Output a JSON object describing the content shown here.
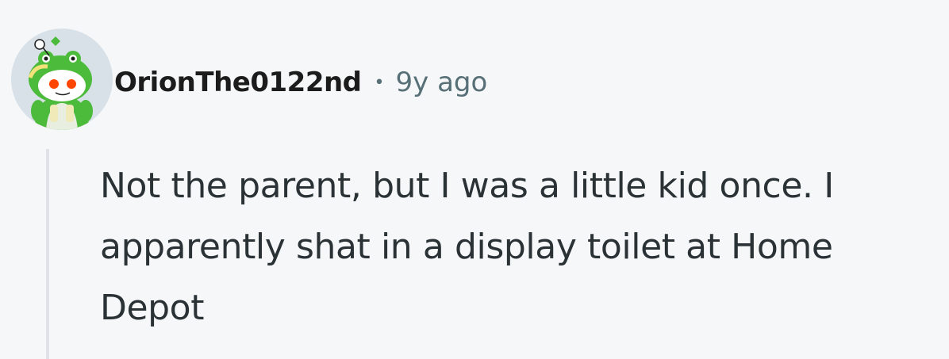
{
  "comment": {
    "author": {
      "username": "OrionThe0122nd",
      "avatar_icon": "snoo-frog-hood-avatar-icon"
    },
    "separator": "•",
    "timestamp": "9y ago",
    "body_lines": [
      "Not the parent, but I was a little kid once. I",
      "apparently shat in a display toilet at Home",
      "Depot"
    ]
  },
  "colors": {
    "background": "#f6f7f8",
    "username": "#1c1c1c",
    "meta": "#576f76",
    "body_text": "#2a3236",
    "thread_line": "#dfe3e7",
    "avatar_bg": "#d8e1e7",
    "avatar_green": "#4cbb3c"
  }
}
